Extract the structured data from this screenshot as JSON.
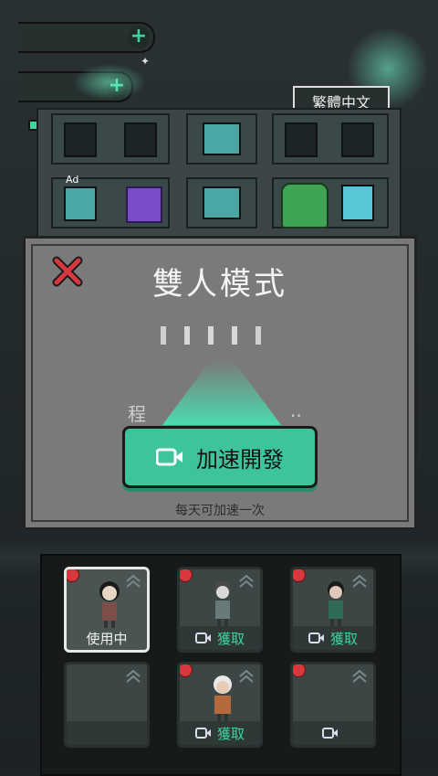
{
  "top": {
    "lang_button": "繁體中文"
  },
  "building": {
    "ad_label": "Ad"
  },
  "modal": {
    "title": "雙人模式",
    "progress_label": "程",
    "progress_dots": "..",
    "speed_button": "加速開發",
    "note": "每天可加速一次"
  },
  "characters": [
    {
      "label": "使用中",
      "state": "selected"
    },
    {
      "label": "獲取",
      "state": "ad"
    },
    {
      "label": "獲取",
      "state": "ad"
    },
    {
      "label": "",
      "state": "ad"
    },
    {
      "label": "獲取",
      "state": "ad"
    },
    {
      "label": "",
      "state": "ad"
    }
  ],
  "colors": {
    "accent": "#3ec49a",
    "modal_bg": "#7a7a7a",
    "close": "#d9363e",
    "badge": "#d9363e"
  }
}
